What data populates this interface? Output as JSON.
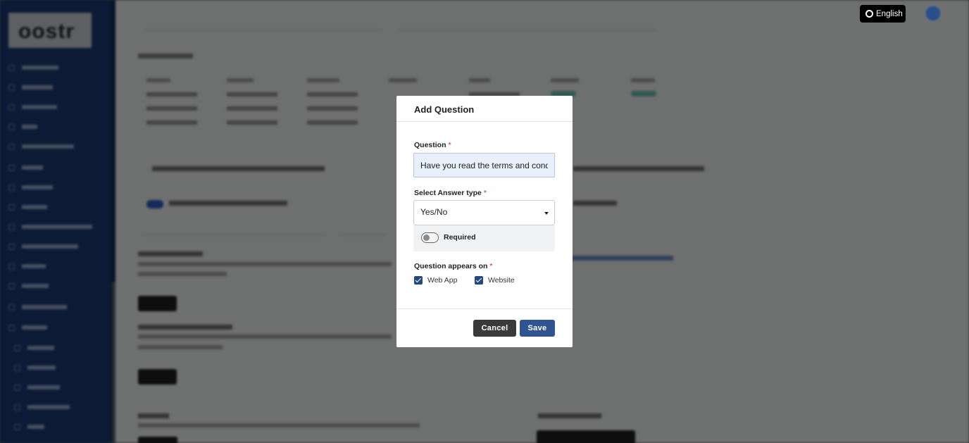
{
  "header": {
    "language_label": "English"
  },
  "modal": {
    "title": "Add Question",
    "question": {
      "label": "Question",
      "required_mark": "*",
      "value": "Have you read the terms and conditi"
    },
    "answer_type": {
      "label": "Select Answer type",
      "required_mark": "*",
      "selected": "Yes/No"
    },
    "required_toggle": {
      "label": "Required",
      "on": false
    },
    "appears_on": {
      "label": "Question appears on",
      "required_mark": "*",
      "options": [
        {
          "label": "Web App",
          "checked": true
        },
        {
          "label": "Website",
          "checked": true
        }
      ]
    },
    "cancel_label": "Cancel",
    "save_label": "Save"
  },
  "colors": {
    "sidebar": "#1b3a75",
    "primary_button": "#2f5490",
    "cancel_button": "#3a3a3a",
    "checkbox": "#24497f",
    "input_fill": "#e8f0fc"
  }
}
